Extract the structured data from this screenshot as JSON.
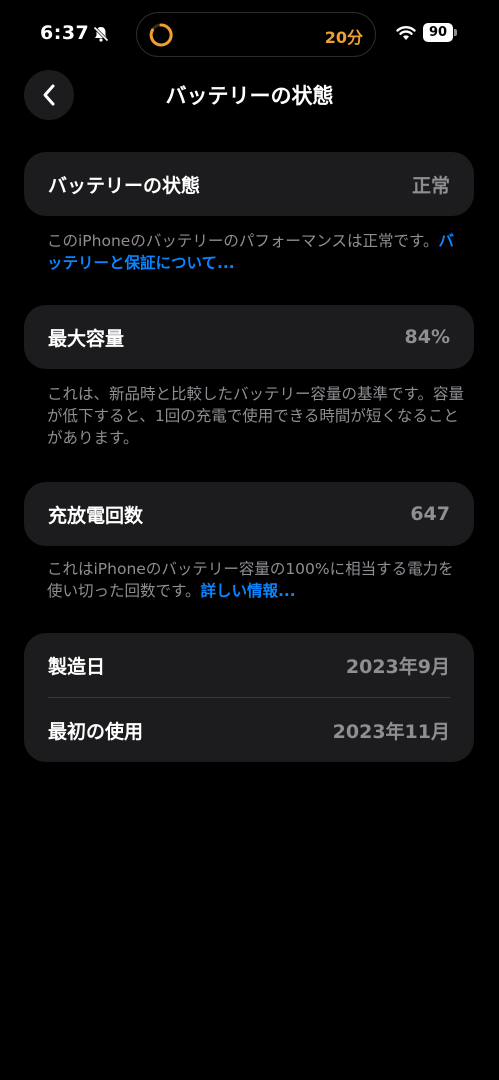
{
  "status": {
    "time": "6:37",
    "timer": "20分",
    "battery": "90"
  },
  "nav": {
    "title": "バッテリーの状態"
  },
  "health": {
    "label": "バッテリーの状態",
    "value": "正常",
    "footnote": "このiPhoneのバッテリーのパフォーマンスは正常です。",
    "link": "バッテリーと保証について..."
  },
  "capacity": {
    "label": "最大容量",
    "value": "84%",
    "footnote": "これは、新品時と比較したバッテリー容量の基準です。容量が低下すると、1回の充電で使用できる時間が短くなることがあります。"
  },
  "cycles": {
    "label": "充放電回数",
    "value": "647",
    "footnote": "これはiPhoneのバッテリー容量の100%に相当する電力を使い切った回数です。",
    "link": "詳しい情報..."
  },
  "dates": {
    "manufacture_label": "製造日",
    "manufacture_value": "2023年9月",
    "first_use_label": "最初の使用",
    "first_use_value": "2023年11月"
  }
}
